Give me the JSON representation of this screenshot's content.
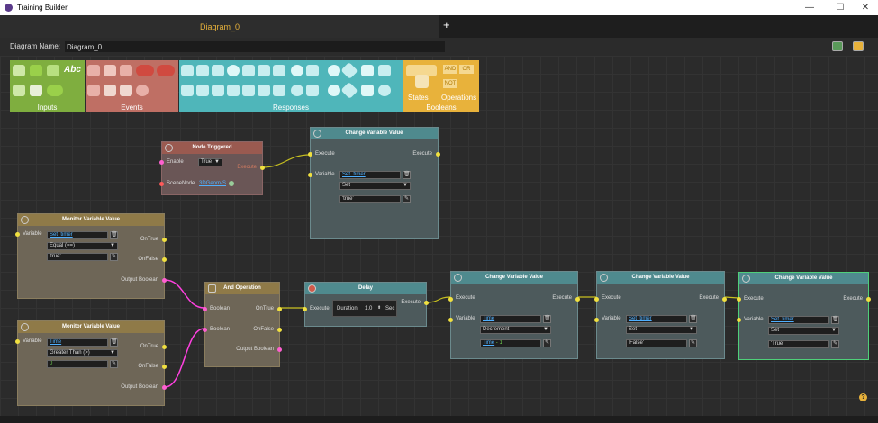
{
  "window": {
    "title": "Training Builder",
    "minimize": "—",
    "maximize": "☐",
    "close": "✕"
  },
  "tabs": [
    {
      "label": "Diagram_0"
    }
  ],
  "tab_add": "+",
  "diagram_name": {
    "label": "Diagram Name:",
    "value": "Diagram_0"
  },
  "palette": {
    "groups": [
      {
        "label": "Inputs",
        "color": "#8bc34a"
      },
      {
        "label": "Events",
        "color": "#c8756a"
      },
      {
        "label": "Responses",
        "color": "#4fb6ba"
      },
      {
        "label": "Booleans",
        "color": "#e8b23b"
      }
    ],
    "states_label": "States",
    "operations_label": "Operations",
    "abc_label": "Abc",
    "and_label": "AND",
    "or_label": "OR",
    "not_label": "NOT"
  },
  "nodes": {
    "node_triggered": {
      "title": "Node Triggered",
      "enable_label": "Enable",
      "enable_value": "True",
      "scenenode_label": "SceneNode",
      "scenenode_value": "3DGeom-S",
      "execute_label": "Execute"
    },
    "change1": {
      "title": "Change Variable Value",
      "execute_in": "Execute",
      "execute_out": "Execute",
      "variable_label": "Variable",
      "variable_value": "Set_timer",
      "op": "Set",
      "value": "'true'"
    },
    "monitor1": {
      "title": "Monitor Variable Value",
      "variable_label": "Variable",
      "variable_value": "Set_timer",
      "cond": "Equal (==)",
      "value": "'true'",
      "on_true": "OnTrue",
      "on_false": "OnFalse",
      "output": "Output Boolean"
    },
    "monitor2": {
      "title": "Monitor Variable Value",
      "variable_label": "Variable",
      "variable_value": "Time",
      "cond": "Greater Than (>)",
      "value": "0",
      "on_true": "OnTrue",
      "on_false": "OnFalse",
      "output": "Output Boolean"
    },
    "and_op": {
      "title": "And Operation",
      "in1": "Boolean",
      "in2": "Boolean",
      "on_true": "OnTrue",
      "on_false": "OnFalse",
      "output": "Output Boolean"
    },
    "delay": {
      "title": "Delay",
      "execute_in": "Execute",
      "execute_out": "Execute",
      "duration_label": "Duration:",
      "duration_value": "1.0",
      "unit": "Sec"
    },
    "change2": {
      "title": "Change Variable Value",
      "execute_in": "Execute",
      "execute_out": "Execute",
      "variable_label": "Variable",
      "variable_value": "Time",
      "op": "Decrement",
      "value_var": "Time",
      "value_rest": " - 1"
    },
    "change3": {
      "title": "Change Variable Value",
      "execute_in": "Execute",
      "execute_out": "Execute",
      "variable_label": "Variable",
      "variable_value": "Set_timer",
      "op": "Set",
      "value": "'False'"
    },
    "change4": {
      "title": "Change Variable Value",
      "execute_in": "Execute",
      "execute_out": "Execute",
      "variable_label": "Variable",
      "variable_value": "Set_timer",
      "op": "Set",
      "value": "'True'"
    }
  },
  "help": "?"
}
